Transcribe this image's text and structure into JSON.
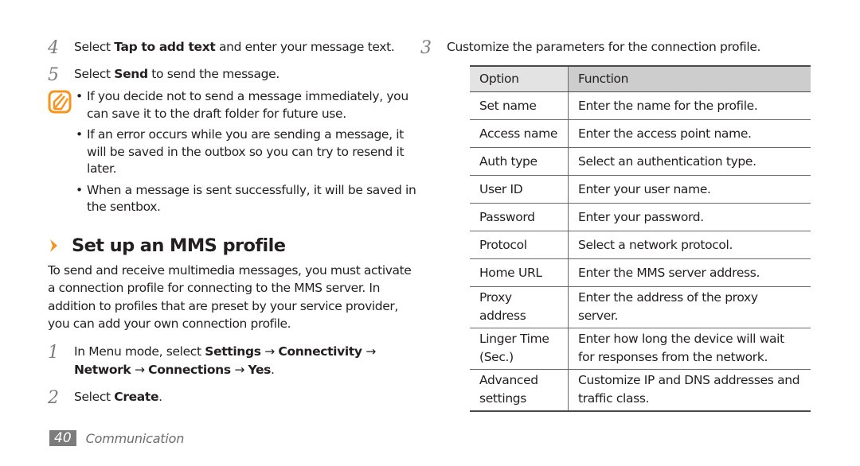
{
  "left": {
    "steps_top": [
      {
        "num": "4",
        "pre": "Select ",
        "bold": "Tap to add text",
        "post": " and enter your message text."
      },
      {
        "num": "5",
        "pre": "Select ",
        "bold": "Send",
        "post": " to send the message."
      }
    ],
    "note": {
      "icon": "note-pencil-icon",
      "bullets": [
        "If you decide not to send a message immediately, you can save it to the draft folder for future use.",
        "If an error occurs while you are sending a message, it will be saved in the outbox so you can try to resend it later.",
        "When a message is sent successfully, it will be saved in the sentbox."
      ]
    },
    "section": {
      "title": "Set up an MMS profile",
      "intro": "To send and receive multimedia messages, you must activate a connection profile for connecting to the MMS server. In addition to profiles that are preset by your service provider, you can add your own connection profile."
    },
    "steps_bottom": [
      {
        "num": "1",
        "pre": "In Menu mode, select ",
        "path": [
          "Settings",
          "Connectivity",
          "Network",
          "Connections",
          "Yes"
        ],
        "arrow": "→",
        "post": "."
      },
      {
        "num": "2",
        "pre": "Select ",
        "bold": "Create",
        "post": "."
      }
    ]
  },
  "right": {
    "step": {
      "num": "3",
      "text": "Customize the parameters for the connection profile."
    },
    "table": {
      "headers": [
        "Option",
        "Function"
      ],
      "rows": [
        [
          "Set name",
          "Enter the name for the profile."
        ],
        [
          "Access name",
          "Enter the access point name."
        ],
        [
          "Auth type",
          "Select an authentication type."
        ],
        [
          "User ID",
          "Enter your user name."
        ],
        [
          "Password",
          "Enter your password."
        ],
        [
          "Protocol",
          "Select a network protocol."
        ],
        [
          "Home URL",
          "Enter the MMS server address."
        ],
        [
          "Proxy address",
          "Enter the address of the proxy server."
        ],
        [
          "Linger Time (Sec.)",
          "Enter how long the device will wait for responses from the network."
        ],
        [
          "Advanced settings",
          "Customize IP and DNS addresses and traffic class."
        ]
      ]
    }
  },
  "footer": {
    "page_number": "40",
    "section": "Communication"
  },
  "colors": {
    "accent": "#f7941d",
    "text": "#231f20",
    "step_number": "#7d7d7d",
    "header_option_bg": "#e3e3e3",
    "header_function_bg": "#cdcdcd",
    "page_badge_bg": "#7c7c7c"
  }
}
